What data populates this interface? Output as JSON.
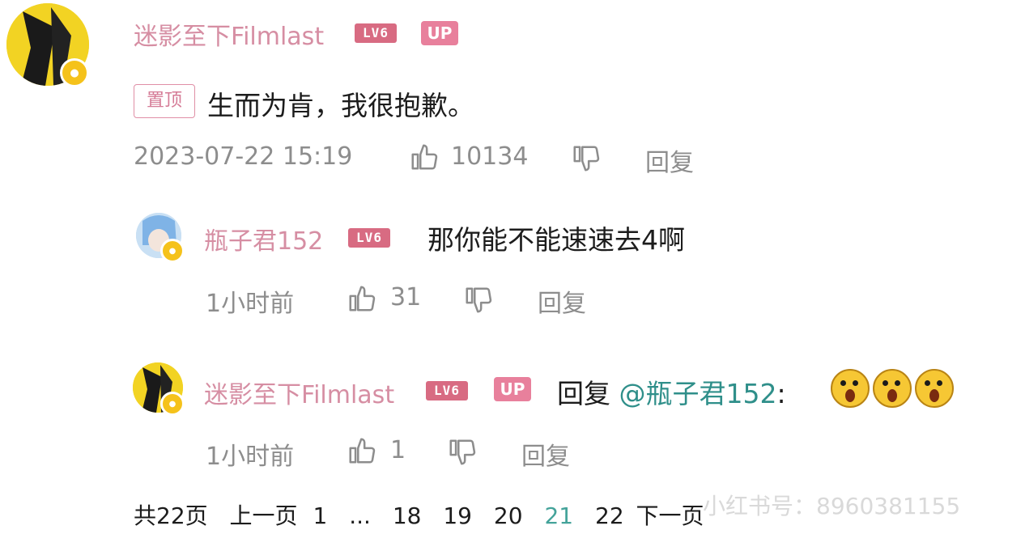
{
  "comment": {
    "username": "迷影至下Filmlast",
    "level": "LV6",
    "up_badge": "UP",
    "pinned_tag": "置顶",
    "text": "生而为肯，我很抱歉。",
    "timestamp": "2023-07-22 15:19",
    "like_count": "10134",
    "reply_label": "回复"
  },
  "replies": [
    {
      "username": "瓶子君152",
      "level": "LV6",
      "text": "那你能不能速速去4啊",
      "time": "1小时前",
      "like_count": "31",
      "reply_label": "回复"
    },
    {
      "username": "迷影至下Filmlast",
      "level": "LV6",
      "up_badge": "UP",
      "reply_prefix": "回复",
      "mention": "@瓶子君152",
      "separator": ":",
      "time": "1小时前",
      "like_count": "1",
      "reply_label": "回复"
    }
  ],
  "pagination": {
    "total": "共22页",
    "prev": "上一页",
    "pages": [
      "1",
      "...",
      "18",
      "19",
      "20",
      "21",
      "22"
    ],
    "current": "21",
    "next": "下一页"
  },
  "watermark": "小红书号：8960381155",
  "colors": {
    "username": "#d68ea3",
    "level_badge": "#d86b82",
    "up_badge": "#e8809c",
    "mention": "#2f8f8a",
    "meta": "#8d8d8d"
  },
  "icons": [
    "thumb-up-icon",
    "thumb-down-icon",
    "verified-badge-icon",
    "shock-emoji-icon"
  ]
}
